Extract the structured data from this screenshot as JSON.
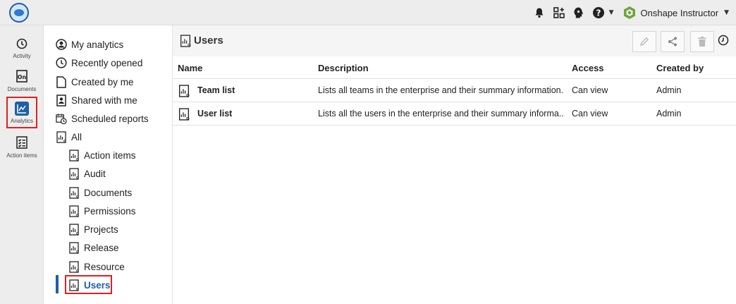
{
  "topbar": {
    "user_name": "Onshape Instructor",
    "icons": [
      "notification-icon",
      "app-store-icon",
      "learning-icon",
      "help-icon"
    ]
  },
  "rail": {
    "items": [
      {
        "label": "Activity",
        "icon": "clock-icon"
      },
      {
        "label": "Documents",
        "icon": "documents-icon"
      },
      {
        "label": "Analytics",
        "icon": "analytics-icon"
      },
      {
        "label": "Action items",
        "icon": "checklist-icon"
      }
    ]
  },
  "nav": {
    "items": [
      {
        "label": "My analytics"
      },
      {
        "label": "Recently opened"
      },
      {
        "label": "Created by me"
      },
      {
        "label": "Shared with me"
      },
      {
        "label": "Scheduled reports"
      },
      {
        "label": "All"
      },
      {
        "label": "Action items"
      },
      {
        "label": "Audit"
      },
      {
        "label": "Documents"
      },
      {
        "label": "Permissions"
      },
      {
        "label": "Projects"
      },
      {
        "label": "Release"
      },
      {
        "label": "Resource"
      },
      {
        "label": "Users"
      }
    ]
  },
  "main": {
    "title": "Users",
    "columns": {
      "name": "Name",
      "description": "Description",
      "access": "Access",
      "created_by": "Created by"
    },
    "rows": [
      {
        "name": "Team list",
        "description": "Lists all teams in the enterprise and their summary information.",
        "access": "Can view",
        "created_by": "Admin"
      },
      {
        "name": "User list",
        "description": "Lists all the users in the enterprise and their summary informa...",
        "access": "Can view",
        "created_by": "Admin"
      }
    ]
  },
  "colors": {
    "accent": "#1f5fa8",
    "highlight": "#e02020"
  }
}
